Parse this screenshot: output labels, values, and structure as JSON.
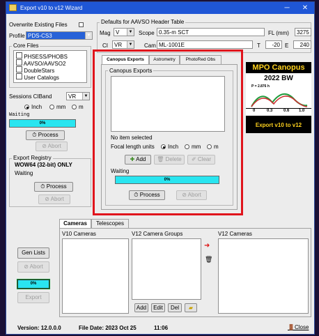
{
  "window": {
    "title": "Export v10 to v12 Wizard",
    "minimize": "─",
    "close": "✕"
  },
  "left": {
    "overwrite_label": "Overwrite Existing Files",
    "profile_label": "Profile",
    "profile_value": "PDS-CS3",
    "core_files_title": "Core Files",
    "core_files": [
      "PHSESS/PHOBS",
      "AAVSO/AAVSO2",
      "DoubleStars",
      "User Catalogs"
    ],
    "sessions_cband_label": "Sessions CIBand",
    "sessions_cband_value": "VR",
    "unit_inch": "Inch",
    "unit_mm": "mm",
    "unit_m": "m",
    "waiting": "Waiting",
    "progress_text": "0%",
    "process": "Process",
    "abort": "Abort",
    "export_registry_title": "Export Registry",
    "registry_note": "WOW64 (32-bit) ONLY",
    "registry_waiting": "Waiting",
    "registry_process": "Process",
    "registry_abort": "Abort",
    "gen_lists": "Gen Lists",
    "lists_abort": "Abort",
    "lists_progress": "0%",
    "export": "Export"
  },
  "header_defaults": {
    "title": "Defaults for AAVSO Header Table",
    "mag_label": "Mag",
    "mag_value": "V",
    "scope_label": "Scope",
    "scope_value": "0.35-m SCT",
    "fl_label": "FL (mm)",
    "fl_value": "3275",
    "ci_label": "CI",
    "ci_value": "VR",
    "cam_label": "Cam",
    "cam_value": "ML-1001E",
    "t_label": "T",
    "t_value": "-20",
    "e_label": "E",
    "e_value": "240"
  },
  "tabs": [
    "Canopus Exports",
    "Astrometry",
    "PhotoRed Obs"
  ],
  "canopus": {
    "group_title": "Canopus Exports",
    "status": "No item selected",
    "focal_label": "Focal length units",
    "unit_inch": "Inch",
    "unit_mm": "mm",
    "unit_m": "m",
    "add": "Add",
    "delete": "Delete",
    "clear": "Clear",
    "waiting": "Waiting",
    "progress_text": "0%",
    "process": "Process",
    "abort": "Abort"
  },
  "logo": {
    "title": "MPO Canopus",
    "year": "2022 BW",
    "period": "P = 2.876 h",
    "ticks": [
      "0",
      "0.3",
      "0.6",
      "1.0"
    ],
    "footer": "Export v10 to v12"
  },
  "camera_tabs": [
    "Cameras",
    "Telescopes"
  ],
  "cameras": {
    "v10_label": "V10 Cameras",
    "v12_groups_label": "V12 Camera Groups",
    "v12_label": "V12 Cameras",
    "add": "Add",
    "edit": "Edit",
    "del": "Del"
  },
  "status_bar": {
    "version": "Version: 12.0.0.0",
    "file_date": "File Date: 2023 Oct 25",
    "time": "11:06",
    "close": "Close"
  },
  "colors": {
    "titlebar": "#1f56d6",
    "progress": "#29e5f0",
    "highlight_box": "#e0141c"
  }
}
